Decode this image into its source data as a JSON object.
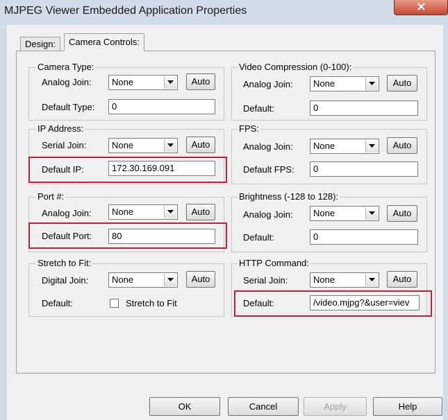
{
  "window": {
    "title": "MJPEG Viewer Embedded Application Properties"
  },
  "tabs": [
    {
      "label": "Design:"
    },
    {
      "label": "Camera Controls:"
    }
  ],
  "groups": {
    "camera_type": {
      "title": "Camera Type:",
      "join_label": "Analog Join:",
      "join_value": "None",
      "auto_label": "Auto",
      "default_label": "Default Type:",
      "default_value": "0"
    },
    "ip_address": {
      "title": "IP Address:",
      "join_label": "Serial Join:",
      "join_value": "None",
      "auto_label": "Auto",
      "default_label": "Default IP:",
      "default_value": "172.30.169.091"
    },
    "port": {
      "title": "Port #:",
      "join_label": "Analog Join:",
      "join_value": "None",
      "auto_label": "Auto",
      "default_label": "Default Port:",
      "default_value": "80"
    },
    "stretch": {
      "title": "Stretch to Fit:",
      "join_label": "Digital Join:",
      "join_value": "None",
      "auto_label": "Auto",
      "default_label": "Default:",
      "checkbox_label": "Stretch to Fit"
    },
    "video_compression": {
      "title": "Video Compression (0-100):",
      "join_label": "Analog Join:",
      "join_value": "None",
      "auto_label": "Auto",
      "default_label": "Default:",
      "default_value": "0"
    },
    "fps": {
      "title": "FPS:",
      "join_label": "Analog Join:",
      "join_value": "None",
      "auto_label": "Auto",
      "default_label": "Default FPS:",
      "default_value": "0"
    },
    "brightness": {
      "title": "Brightness (-128 to 128):",
      "join_label": "Analog Join:",
      "join_value": "None",
      "auto_label": "Auto",
      "default_label": "Default:",
      "default_value": "0"
    },
    "http_command": {
      "title": "HTTP Command:",
      "join_label": "Serial Join:",
      "join_value": "None",
      "auto_label": "Auto",
      "default_label": "Default:",
      "default_value": "/video.mjpg?&user=viev"
    }
  },
  "buttons": {
    "ok": "OK",
    "cancel": "Cancel",
    "apply": "Apply",
    "help": "Help"
  },
  "colors": {
    "highlight": "#c41e3a",
    "panel": "#f0f0f0"
  }
}
